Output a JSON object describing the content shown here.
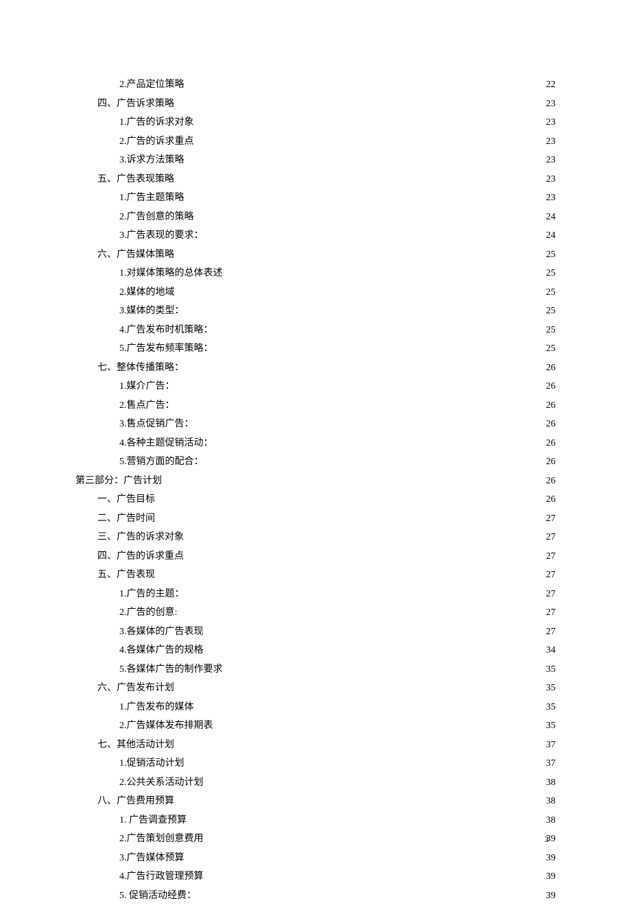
{
  "toc": [
    {
      "indent": 2,
      "label": "2.产品定位策略",
      "page": "22"
    },
    {
      "indent": 1,
      "label": "四、广告诉求策略",
      "page": "23"
    },
    {
      "indent": 2,
      "label": "1.广告的诉求对象",
      "page": "23"
    },
    {
      "indent": 2,
      "label": "2.广告的诉求重点",
      "page": "23"
    },
    {
      "indent": 2,
      "label": "3.诉求方法策略",
      "page": "23"
    },
    {
      "indent": 1,
      "label": "五、广告表现策略",
      "page": "23"
    },
    {
      "indent": 2,
      "label": "1.广告主题策略",
      "page": "23"
    },
    {
      "indent": 2,
      "label": "2.广告创意的策略",
      "page": "24"
    },
    {
      "indent": 2,
      "label": "3.广告表现的要求：",
      "page": "24"
    },
    {
      "indent": 1,
      "label": "六、广告媒体策略",
      "page": "25"
    },
    {
      "indent": 2,
      "label": "1.对媒体策略的总体表述",
      "page": "25"
    },
    {
      "indent": 2,
      "label": "2.媒体的地域",
      "page": "25"
    },
    {
      "indent": 2,
      "label": "3.媒体的类型：",
      "page": "25"
    },
    {
      "indent": 2,
      "label": "4.广告发布时机策略：",
      "page": "25"
    },
    {
      "indent": 2,
      "label": "5.广告发布频率策略：",
      "page": "25"
    },
    {
      "indent": 1,
      "label": "七、整体传播策略：",
      "page": "26"
    },
    {
      "indent": 2,
      "label": "1.媒介广告：",
      "page": "26"
    },
    {
      "indent": 2,
      "label": "2.售点广告：",
      "page": "26"
    },
    {
      "indent": 2,
      "label": "3.售点促销广告：",
      "page": "26"
    },
    {
      "indent": 2,
      "label": "4.各种主题促销活动：",
      "page": "26"
    },
    {
      "indent": 2,
      "label": "5.营销方面的配合：",
      "page": "26"
    },
    {
      "indent": 0,
      "label": "第三部分：广告计划",
      "page": "26"
    },
    {
      "indent": 1,
      "label": "一、广告目标",
      "page": "26"
    },
    {
      "indent": 1,
      "label": "二、广告时间",
      "page": "27"
    },
    {
      "indent": 1,
      "label": "三、广告的诉求对象",
      "page": "27"
    },
    {
      "indent": 1,
      "label": "四、广告的诉求重点",
      "page": "27"
    },
    {
      "indent": 1,
      "label": "五、广告表现",
      "page": "27"
    },
    {
      "indent": 2,
      "label": "1.广告的主题：",
      "page": "27"
    },
    {
      "indent": 2,
      "label": "2.广告的创意:",
      "page": "27"
    },
    {
      "indent": 2,
      "label": "3.各媒体的广告表现",
      "page": "27"
    },
    {
      "indent": 2,
      "label": "4.各媒体广告的规格",
      "page": "34"
    },
    {
      "indent": 2,
      "label": "5.各媒体广告的制作要求",
      "page": "35"
    },
    {
      "indent": 1,
      "label": "六、广告发布计划",
      "page": "35"
    },
    {
      "indent": 2,
      "label": "1.广告发布的媒体",
      "page": "35"
    },
    {
      "indent": 2,
      "label": "2.广告媒体发布排期表",
      "page": "35"
    },
    {
      "indent": 1,
      "label": "七、其他活动计划",
      "page": "37"
    },
    {
      "indent": 2,
      "label": "1.促销活动计划",
      "page": "37"
    },
    {
      "indent": 2,
      "label": "2.公共关系活动计划",
      "page": "38"
    },
    {
      "indent": 1,
      "label": "八、广告费用预算",
      "page": "38"
    },
    {
      "indent": 2,
      "label": "1. 广告调查预算",
      "page": "38"
    },
    {
      "indent": 2,
      "label": "2.广告策划创意费用",
      "page": "39"
    },
    {
      "indent": 2,
      "label": "3.广告媒体预算",
      "page": "39"
    },
    {
      "indent": 2,
      "label": "4.广告行政管理预算",
      "page": "39"
    },
    {
      "indent": 2,
      "label": "5. 促销活动经费：",
      "page": "39"
    }
  ],
  "footer": {
    "page_number": "3"
  }
}
